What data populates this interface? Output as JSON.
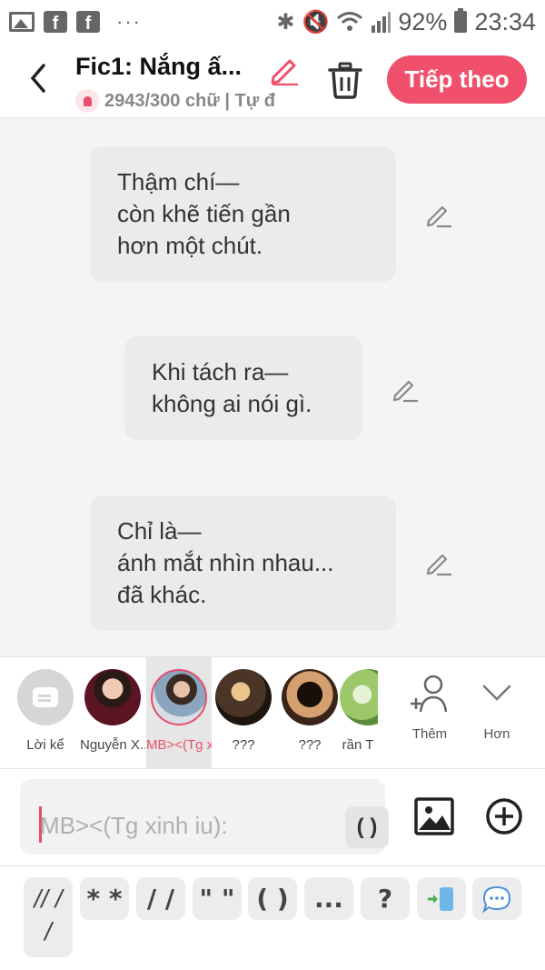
{
  "status_bar": {
    "left_icons": [
      "gallery-icon",
      "facebook-icon",
      "facebook-icon"
    ],
    "dots": "···",
    "battery": "92%",
    "time": "23:34"
  },
  "header": {
    "title": "Fic1: Nắng ấ...",
    "word_count": "2943/300 chữ | Tự đ",
    "next_label": "Tiếp theo",
    "accent_color": "#f0506b"
  },
  "messages": [
    {
      "lines": [
        "Thậm chí—",
        "còn khẽ tiến gần",
        "hơn một chút."
      ]
    },
    {
      "lines": [
        "Khi tách ra—",
        "không ai nói gì."
      ]
    },
    {
      "lines": [
        "Chỉ là—",
        "ánh mắt nhìn nhau...",
        "đã khác."
      ]
    }
  ],
  "characters": [
    {
      "name": "Lời kể"
    },
    {
      "name": "Nguyễn X..."
    },
    {
      "name": "MB><(Tg x..."
    },
    {
      "name": "???"
    },
    {
      "name": "???"
    },
    {
      "name": "rần T"
    }
  ],
  "more": {
    "add_label": "Thêm",
    "expand_label": "Hơn"
  },
  "input": {
    "placeholder": "MB><(Tg xinh iu):",
    "paren_label": "( )"
  },
  "quick_keys": [
    {
      "label": "// /\n/"
    },
    {
      "label": "* *"
    },
    {
      "label": "/ /"
    },
    {
      "label": "\" \""
    },
    {
      "label": "( )"
    },
    {
      "label": "..."
    },
    {
      "label": "?"
    }
  ]
}
